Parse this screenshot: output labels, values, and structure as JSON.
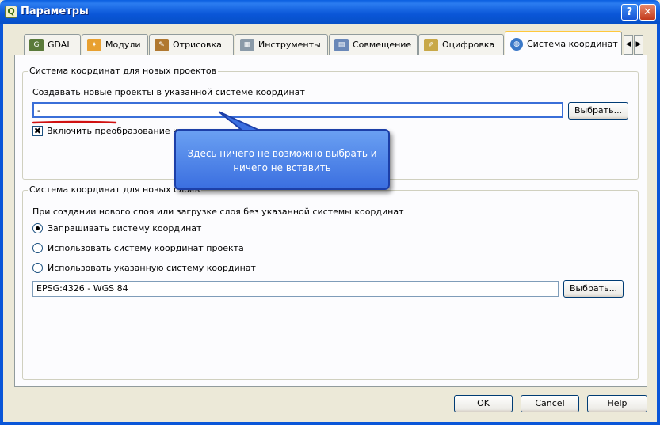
{
  "window": {
    "title": "Параметры",
    "help_glyph": "?",
    "close_glyph": "✕",
    "app_icon_glyph": "Q"
  },
  "tabs": [
    {
      "label": "GDAL",
      "icon": "gdal-icon"
    },
    {
      "label": "Модули",
      "icon": "plugins-icon"
    },
    {
      "label": "Отрисовка",
      "icon": "brush-icon"
    },
    {
      "label": "Инструменты",
      "icon": "tools-icon"
    },
    {
      "label": "Совмещение",
      "icon": "overlay-icon"
    },
    {
      "label": "Оцифровка",
      "icon": "digitize-icon"
    },
    {
      "label": "Система координат",
      "icon": "globe-icon",
      "active": true
    }
  ],
  "tab_scroll": {
    "left": "◀",
    "right": "▶"
  },
  "projects_group": {
    "title": "Система координат для новых проектов",
    "description": "Создавать новые проекты в указанной системе координат",
    "crs_value": "-",
    "choose_label": "Выбрать...",
    "checkbox_label": "Включить преобразование координат на лету",
    "checkbox_checked": true,
    "checkbox_glyph": "✖"
  },
  "layers_group": {
    "title": "Система координат для новых слоёв",
    "description": "При создании нового слоя или загрузке слоя без указанной системы координат",
    "options": [
      {
        "label": "Запрашивать систему координат",
        "selected": true
      },
      {
        "label": "Использовать систему координат проекта",
        "selected": false
      },
      {
        "label": "Использовать указанную систему координат",
        "selected": false
      }
    ],
    "crs_value": "EPSG:4326 - WGS 84",
    "choose_label": "Выбрать..."
  },
  "callout": {
    "line1": "Здесь ничего не возможно выбрать и",
    "line2": "ничего не вставить"
  },
  "footer": {
    "ok_label": "OK",
    "cancel_label": "Cancel",
    "help_label": "Help"
  },
  "colors": {
    "titlebar": "#0a56d8",
    "callout": "#3b6fe0",
    "annotation_red": "#d01010",
    "active_tab_accent": "#ffc83c"
  }
}
